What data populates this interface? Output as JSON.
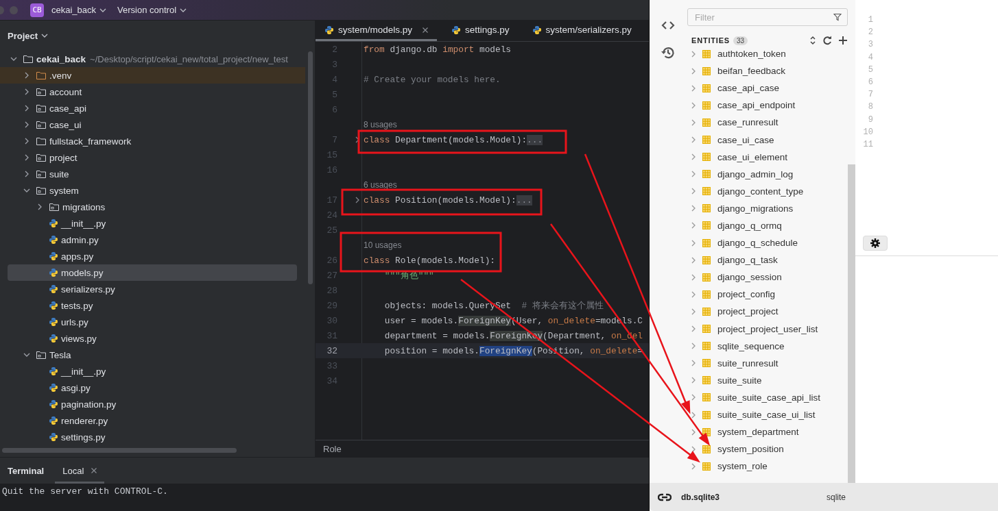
{
  "titlebar": {
    "badge": "CB",
    "project": "cekai_back",
    "vcs": "Version control"
  },
  "project_panel": {
    "title": "Project",
    "tree": [
      {
        "name": "cekai_back",
        "path": "~/Desktop/script/cekai_new/total_project/new_test",
        "kind": "folder",
        "expanded": true,
        "selected": false,
        "children": [
          {
            "name": ".venv",
            "kind": "excluded",
            "expanded": false,
            "selected": false
          },
          {
            "name": "account",
            "kind": "module",
            "expanded": false,
            "selected": false
          },
          {
            "name": "case_api",
            "kind": "module",
            "expanded": false,
            "selected": false
          },
          {
            "name": "case_ui",
            "kind": "module",
            "expanded": false,
            "selected": false
          },
          {
            "name": "fullstack_framework",
            "kind": "folder",
            "expanded": false,
            "selected": false
          },
          {
            "name": "project",
            "kind": "module",
            "expanded": false,
            "selected": false
          },
          {
            "name": "suite",
            "kind": "module",
            "expanded": false,
            "selected": false
          },
          {
            "name": "system",
            "kind": "module",
            "expanded": true,
            "selected": false,
            "children": [
              {
                "name": "migrations",
                "kind": "module",
                "expanded": false,
                "selected": false
              },
              {
                "name": "__init__.py",
                "kind": "python",
                "selected": false
              },
              {
                "name": "admin.py",
                "kind": "python",
                "selected": false
              },
              {
                "name": "apps.py",
                "kind": "python",
                "selected": false
              },
              {
                "name": "models.py",
                "kind": "python",
                "selected": true
              },
              {
                "name": "serializers.py",
                "kind": "python",
                "selected": false
              },
              {
                "name": "tests.py",
                "kind": "python",
                "selected": false
              },
              {
                "name": "urls.py",
                "kind": "python",
                "selected": false
              },
              {
                "name": "views.py",
                "kind": "python",
                "selected": false
              }
            ]
          },
          {
            "name": "Tesla",
            "kind": "module",
            "expanded": true,
            "selected": false,
            "children": [
              {
                "name": "__init__.py",
                "kind": "python",
                "selected": false
              },
              {
                "name": "asgi.py",
                "kind": "python",
                "selected": false
              },
              {
                "name": "pagination.py",
                "kind": "python",
                "selected": false
              },
              {
                "name": "renderer.py",
                "kind": "python",
                "selected": false
              },
              {
                "name": "settings.py",
                "kind": "python",
                "selected": false
              }
            ]
          }
        ]
      }
    ]
  },
  "editor": {
    "tabs": [
      {
        "label": "system/models.py",
        "selected": true
      },
      {
        "label": "settings.py",
        "selected": false
      },
      {
        "label": "system/serializers.py",
        "selected": false
      }
    ],
    "lines": [
      {
        "kind": "code",
        "number": "2",
        "current": false,
        "folded": false,
        "tokens": [
          {
            "kind": "keyword",
            "text": "from"
          },
          {
            "kind": "plain",
            "text": " django.db "
          },
          {
            "kind": "keyword",
            "text": "import"
          },
          {
            "kind": "plain",
            "text": " models"
          }
        ]
      },
      {
        "kind": "code",
        "number": "3",
        "current": false,
        "folded": false
      },
      {
        "kind": "code",
        "number": "4",
        "current": false,
        "folded": false,
        "tokens": [
          {
            "kind": "comment",
            "text": "# Create your models here."
          }
        ]
      },
      {
        "kind": "code",
        "number": "5",
        "current": false,
        "folded": false
      },
      {
        "kind": "code",
        "number": "6",
        "current": false,
        "folded": false
      },
      {
        "kind": "hint",
        "text": "8 usages"
      },
      {
        "kind": "code",
        "number": "7",
        "current": false,
        "folded": true,
        "tokens": [
          {
            "kind": "keyword",
            "text": "class"
          },
          {
            "kind": "plain",
            "text": " Department(models.Model):"
          },
          {
            "kind": "fold",
            "text": "..."
          }
        ]
      },
      {
        "kind": "code",
        "number": "15",
        "current": false,
        "folded": false
      },
      {
        "kind": "code",
        "number": "16",
        "current": false,
        "folded": false
      },
      {
        "kind": "hint",
        "text": "6 usages"
      },
      {
        "kind": "code",
        "number": "17",
        "current": false,
        "folded": true,
        "tokens": [
          {
            "kind": "keyword",
            "text": "class"
          },
          {
            "kind": "plain",
            "text": " Position(models.Model):"
          },
          {
            "kind": "fold",
            "text": "..."
          }
        ]
      },
      {
        "kind": "code",
        "number": "24",
        "current": false,
        "folded": false
      },
      {
        "kind": "code",
        "number": "25",
        "current": false,
        "folded": false
      },
      {
        "kind": "hint",
        "text": "10 usages"
      },
      {
        "kind": "code",
        "number": "26",
        "current": false,
        "folded": false,
        "tokens": [
          {
            "kind": "keyword",
            "text": "class"
          },
          {
            "kind": "plain",
            "text": " Role(models.Model):"
          }
        ]
      },
      {
        "kind": "code",
        "number": "27",
        "current": false,
        "folded": false,
        "tokens": [
          {
            "kind": "string",
            "text": "    \"\"\"角色\"\"\""
          }
        ]
      },
      {
        "kind": "code",
        "number": "28",
        "current": false,
        "folded": false
      },
      {
        "kind": "code",
        "number": "29",
        "current": false,
        "folded": false,
        "tokens": [
          {
            "kind": "plain",
            "text": "    objects: models.QuerySet  "
          },
          {
            "kind": "comment",
            "text": "# 将来会有这个属性"
          }
        ]
      },
      {
        "kind": "code",
        "number": "30",
        "current": false,
        "folded": false,
        "tokens": [
          {
            "kind": "plain",
            "text": "    user = models."
          },
          {
            "kind": "match",
            "text": "ForeignKey"
          },
          {
            "kind": "plain",
            "text": "(User, "
          },
          {
            "kind": "param",
            "text": "on_delete"
          },
          {
            "kind": "plain",
            "text": "=models.C"
          }
        ]
      },
      {
        "kind": "code",
        "number": "31",
        "current": false,
        "folded": false,
        "tokens": [
          {
            "kind": "plain",
            "text": "    department = models."
          },
          {
            "kind": "match",
            "text": "ForeignKey"
          },
          {
            "kind": "plain",
            "text": "(Department, "
          },
          {
            "kind": "param",
            "text": "on_del"
          }
        ]
      },
      {
        "kind": "code",
        "number": "32",
        "current": true,
        "folded": false,
        "tokens": [
          {
            "kind": "plain",
            "text": "    position = models."
          },
          {
            "kind": "selection",
            "text": "ForeignKey"
          },
          {
            "kind": "plain",
            "text": "(Position, "
          },
          {
            "kind": "param",
            "text": "on_delete"
          },
          {
            "kind": "plain",
            "text": "="
          }
        ]
      },
      {
        "kind": "code",
        "number": "33",
        "current": false,
        "folded": false
      },
      {
        "kind": "code",
        "number": "34",
        "current": false,
        "folded": false
      }
    ],
    "breadcrumb": "Role"
  },
  "terminal": {
    "title": "Terminal",
    "tabs": [
      {
        "label": "Local",
        "selected": true
      }
    ],
    "output": "Quit the server with CONTROL-C."
  },
  "db_panel": {
    "filter": {
      "placeholder": "Filter"
    },
    "entities_title": "ENTITIES",
    "entities_count": "33",
    "entities": [
      {
        "name": "authtoken_token"
      },
      {
        "name": "beifan_feedback"
      },
      {
        "name": "case_api_case"
      },
      {
        "name": "case_api_endpoint"
      },
      {
        "name": "case_runresult"
      },
      {
        "name": "case_ui_case"
      },
      {
        "name": "case_ui_element"
      },
      {
        "name": "django_admin_log"
      },
      {
        "name": "django_content_type"
      },
      {
        "name": "django_migrations"
      },
      {
        "name": "django_q_ormq"
      },
      {
        "name": "django_q_schedule"
      },
      {
        "name": "django_q_task"
      },
      {
        "name": "django_session"
      },
      {
        "name": "project_config"
      },
      {
        "name": "project_project"
      },
      {
        "name": "project_project_user_list"
      },
      {
        "name": "sqlite_sequence"
      },
      {
        "name": "suite_runresult"
      },
      {
        "name": "suite_suite"
      },
      {
        "name": "suite_suite_case_api_list"
      },
      {
        "name": "suite_suite_case_ui_list"
      },
      {
        "name": "system_department"
      },
      {
        "name": "system_position"
      },
      {
        "name": "system_role"
      }
    ],
    "query_line_numbers": [
      "1",
      "2",
      "3",
      "4",
      "5",
      "6",
      "7",
      "8",
      "9",
      "10",
      "11"
    ],
    "connection": "db.sqlite3",
    "driver": "sqlite"
  },
  "annotations": [
    {
      "kind": "box"
    },
    {
      "kind": "box"
    },
    {
      "kind": "box"
    },
    {
      "kind": "arrow"
    },
    {
      "kind": "arrow"
    },
    {
      "kind": "arrow"
    }
  ]
}
